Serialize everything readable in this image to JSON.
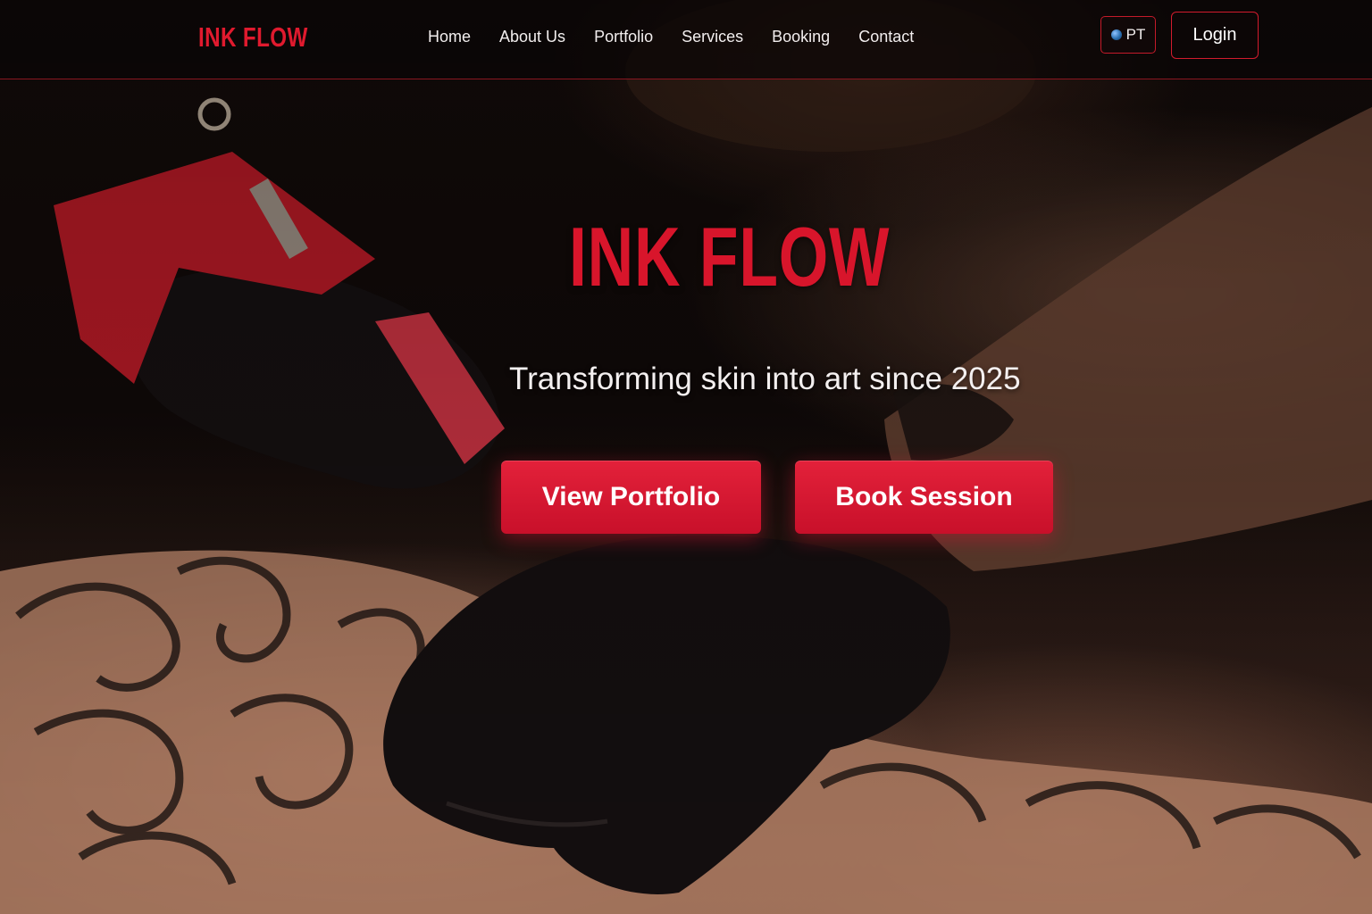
{
  "header": {
    "logo": "INK FLOW",
    "nav": [
      {
        "label": "Home"
      },
      {
        "label": "About Us"
      },
      {
        "label": "Portfolio"
      },
      {
        "label": "Services"
      },
      {
        "label": "Booking"
      },
      {
        "label": "Contact"
      }
    ],
    "language": {
      "label": "PT",
      "icon": "globe-icon"
    },
    "login_label": "Login"
  },
  "hero": {
    "title": "INK FLOW",
    "tagline": "Transforming skin into art since 2025",
    "buttons": {
      "portfolio": "View Portfolio",
      "book": "Book Session"
    }
  },
  "colors": {
    "accent": "#d8152b",
    "header_bg": "#0a0606",
    "text": "#f2eeee"
  }
}
